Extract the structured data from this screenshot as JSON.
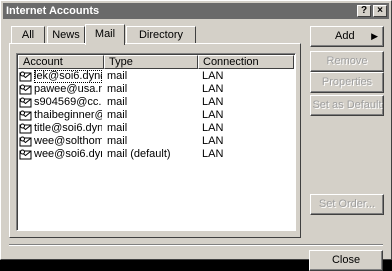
{
  "window": {
    "title": "Internet Accounts",
    "help_glyph": "?",
    "close_glyph": "×"
  },
  "tabs": [
    {
      "label": "All",
      "active": false
    },
    {
      "label": "News",
      "active": false
    },
    {
      "label": "Mail",
      "active": true
    },
    {
      "label": "Directory Service",
      "active": false
    }
  ],
  "list": {
    "columns": [
      "Account",
      "Type",
      "Connection"
    ],
    "rows": [
      {
        "account": "lek@soi6.dyndn...",
        "type": "mail",
        "connection": "LAN"
      },
      {
        "account": "pawee@usa.net",
        "type": "mail",
        "connection": "LAN"
      },
      {
        "account": "s904569@cc.k...",
        "type": "mail",
        "connection": "LAN"
      },
      {
        "account": "thaibeginner@s...",
        "type": "mail",
        "connection": "LAN"
      },
      {
        "account": "title@soi6.dyndn...",
        "type": "mail",
        "connection": "LAN"
      },
      {
        "account": "wee@solthome....",
        "type": "mail",
        "connection": "LAN"
      },
      {
        "account": "wee@soi6.dynd...",
        "type": "mail (default)",
        "connection": "LAN"
      }
    ]
  },
  "buttons": {
    "add": "Add",
    "add_arrow": "▶",
    "remove": "Remove",
    "properties": "Properties",
    "set_default": "Set as Default",
    "set_order": "Set Order...",
    "close": "Close"
  },
  "icons": {
    "account": "mail-account-icon"
  }
}
